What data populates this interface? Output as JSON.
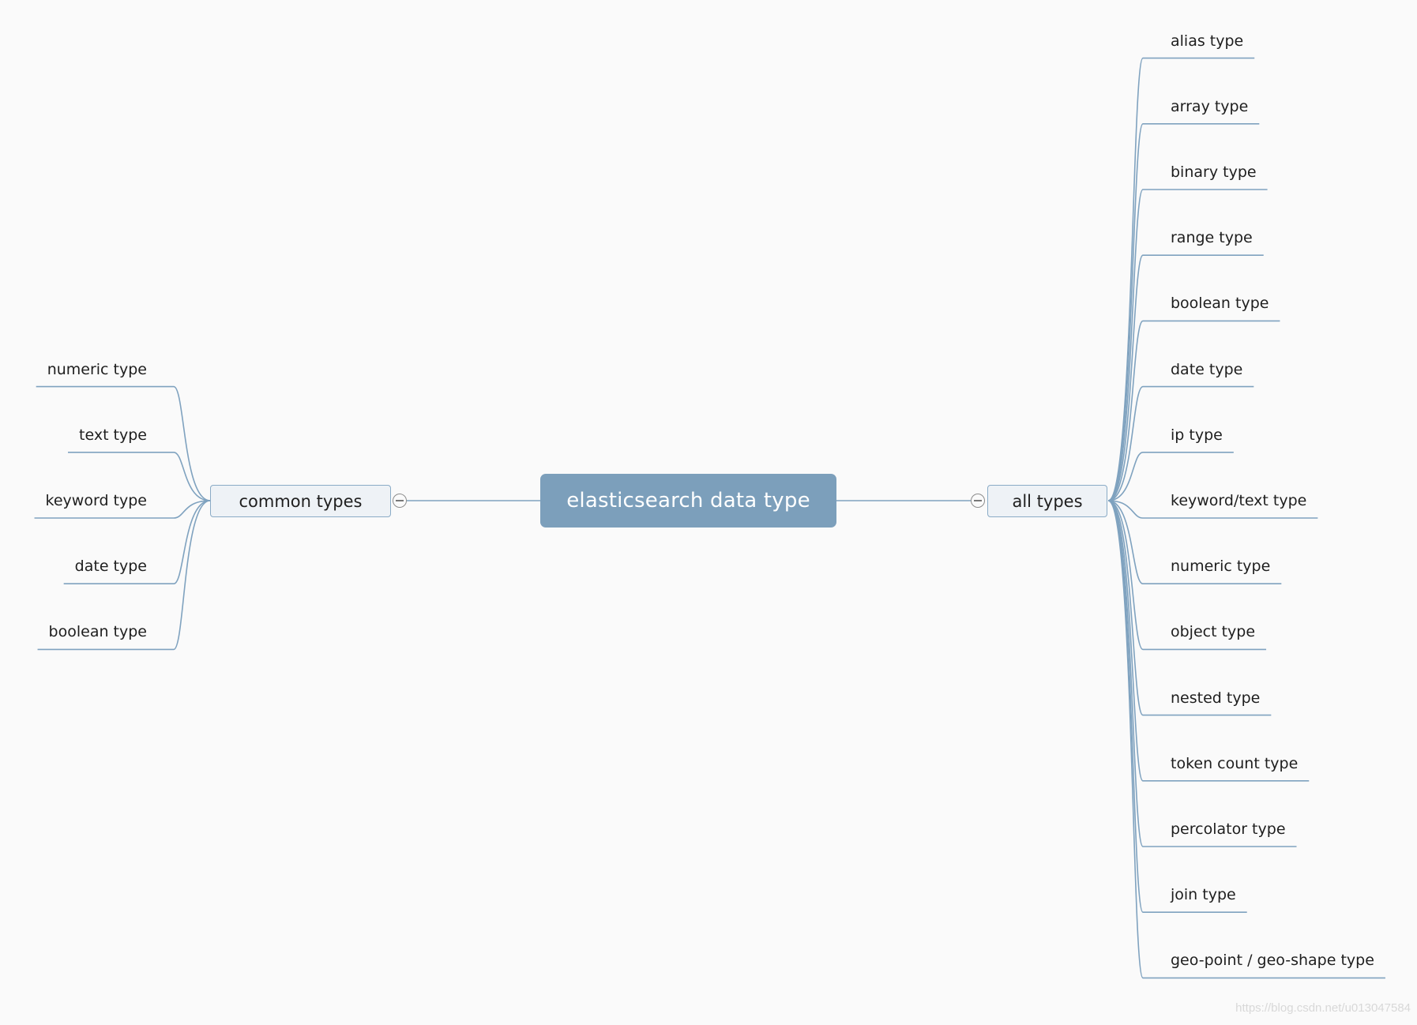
{
  "mindmap": {
    "root": {
      "label": "elasticsearch data type",
      "icon": "none"
    },
    "branches": {
      "left": {
        "label": "common types",
        "collapse_icon": "minus-circle-icon",
        "children": [
          "numeric type",
          "text type",
          "keyword type",
          "date type",
          "boolean type"
        ]
      },
      "right": {
        "label": "all types",
        "collapse_icon": "minus-circle-icon",
        "children": [
          "alias type",
          "array type",
          "binary type",
          "range type",
          "boolean type",
          "date type",
          "ip type",
          "keyword/text type",
          "numeric type",
          "object type",
          "nested type",
          "token count type",
          "percolator type",
          "join type",
          "geo-point / geo-shape type"
        ]
      }
    }
  },
  "colors": {
    "root_fill": "#7c9fbb",
    "link": "#7fa2bf",
    "node_fill": "#eef2f6",
    "node_border": "#8aabc6",
    "background": "#fafafa"
  },
  "watermark": "https://blog.csdn.net/u013047584"
}
